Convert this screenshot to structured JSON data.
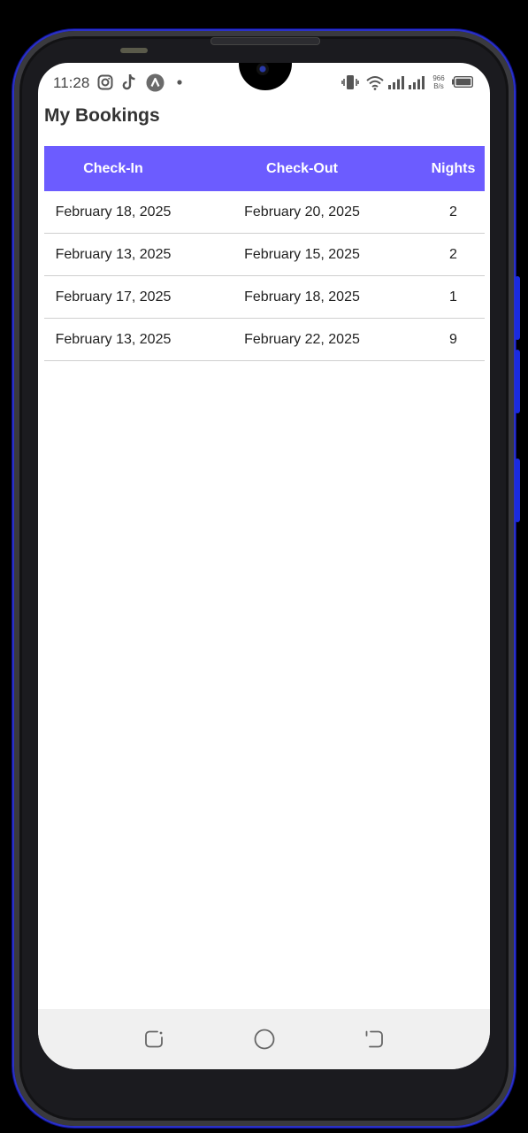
{
  "status_bar": {
    "time": "11:28",
    "net_speed_value": "966",
    "net_speed_unit": "B/s",
    "icons": [
      "instagram-icon",
      "tiktok-icon",
      "nav-app-icon",
      "notification-dot-icon",
      "vibrate-icon",
      "wifi-icon",
      "signal-1-icon",
      "signal-2-icon",
      "battery-icon"
    ]
  },
  "page": {
    "title": "My Bookings"
  },
  "table": {
    "headers": {
      "check_in": "Check-In",
      "check_out": "Check-Out",
      "nights": "Nights"
    },
    "rows": [
      {
        "check_in": "February 18, 2025",
        "check_out": "February 20, 2025",
        "nights": "2"
      },
      {
        "check_in": "February 13, 2025",
        "check_out": "February 15, 2025",
        "nights": "2"
      },
      {
        "check_in": "February 17, 2025",
        "check_out": "February 18, 2025",
        "nights": "1"
      },
      {
        "check_in": "February 13, 2025",
        "check_out": "February 22, 2025",
        "nights": "9"
      }
    ]
  },
  "colors": {
    "header_bg": "#6c5cff",
    "header_text": "#ffffff",
    "frame_accent": "#2b31c9"
  },
  "nav_bar": {
    "icons": [
      "recents-icon",
      "home-icon",
      "back-icon"
    ]
  }
}
